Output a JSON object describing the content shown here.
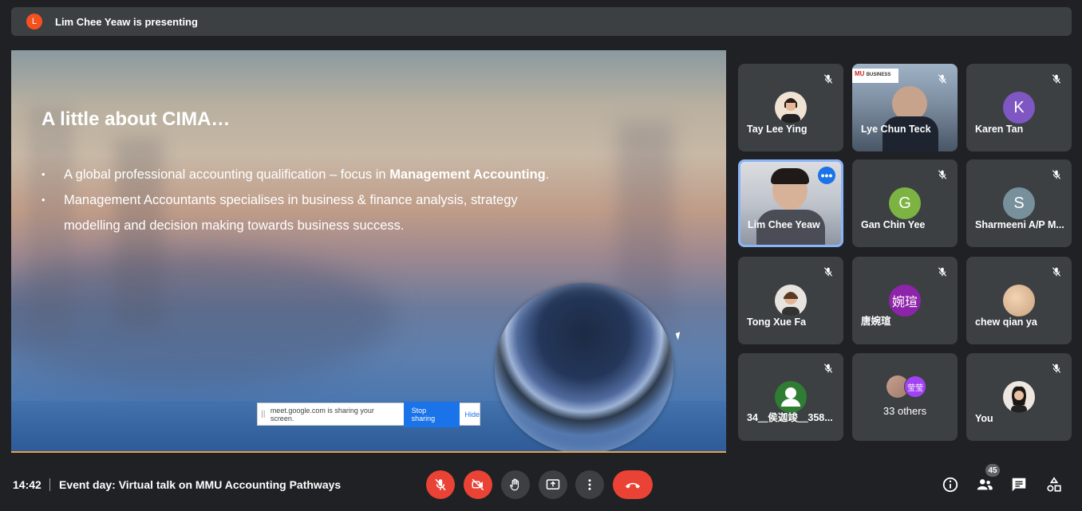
{
  "banner": {
    "avatar_letter": "L",
    "presenting_text": "Lim Chee Yeaw is presenting"
  },
  "slide": {
    "title": "A little about CIMA…",
    "bullet1_pre": "A global professional accounting qualification – focus in ",
    "bullet1_bold": "Management Accounting",
    "bullet1_post": ".",
    "bullet2_line1": "Management Accountants specialises in business & finance analysis, strategy",
    "bullet2_line2": "modelling and decision making towards business success.",
    "bullet_char": "•"
  },
  "share_bar": {
    "message": "meet.google.com is sharing your screen.",
    "stop_label": "Stop sharing",
    "hide_label": "Hide"
  },
  "participants": [
    {
      "name": "Tay Lee Ying",
      "type": "photo",
      "muted": true
    },
    {
      "name": "Lye Chun Teck",
      "type": "video",
      "muted": true
    },
    {
      "name": "Karen Tan",
      "type": "letter",
      "letter": "K",
      "color": "#7e57c2",
      "muted": true
    },
    {
      "name": "Lim Chee Yeaw",
      "type": "video",
      "muted": false,
      "active": true
    },
    {
      "name": "Gan Chin Yee",
      "type": "letter",
      "letter": "G",
      "color": "#7cb342",
      "muted": true
    },
    {
      "name": "Sharmeeni A/P M...",
      "type": "letter",
      "letter": "S",
      "color": "#78909c",
      "muted": true
    },
    {
      "name": "Tong Xue Fa",
      "type": "photo",
      "muted": true
    },
    {
      "name": "唐婉瑄",
      "type": "letter",
      "letter": "婉瑄",
      "color": "#8e24aa",
      "muted": true
    },
    {
      "name": "chew qian ya",
      "type": "photo",
      "muted": true
    },
    {
      "name": "34＿侯迦竣＿358...",
      "type": "photo",
      "muted": true
    },
    {
      "name": "33 others",
      "type": "group",
      "letter": "莹莹"
    },
    {
      "name": "You",
      "type": "photo",
      "muted": true
    }
  ],
  "video_logo_text": "MU",
  "video_logo_sub": "BUSINESS",
  "bottom": {
    "time": "14:42",
    "meeting_title": "Event day: Virtual talk on MMU Accounting Pathways",
    "participant_count": "45"
  },
  "colors": {
    "danger": "#ea4335",
    "accent": "#1a73e8",
    "bg": "#202124",
    "tile": "#3c4043"
  }
}
